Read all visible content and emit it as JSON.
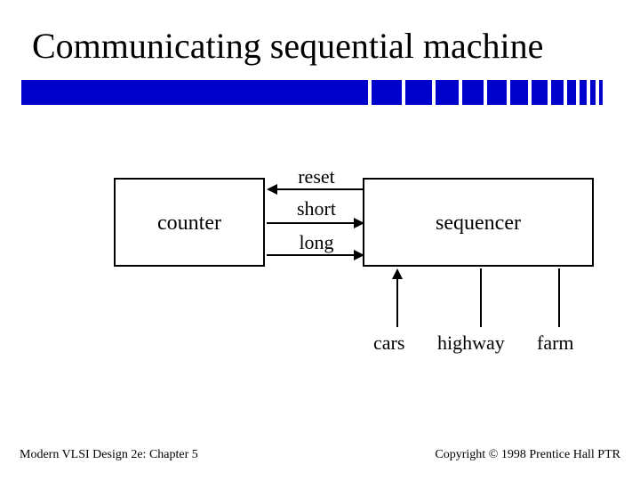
{
  "title": "Communicating sequential machine",
  "boxes": {
    "counter": "counter",
    "sequencer": "sequencer"
  },
  "signals": {
    "reset": "reset",
    "short": "short",
    "long": "long"
  },
  "io": {
    "cars": "cars",
    "highway": "highway",
    "farm": "farm"
  },
  "footer": {
    "left": "Modern VLSI Design 2e: Chapter 5",
    "right": "Copyright © 1998 Prentice Hall PTR"
  },
  "colors": {
    "accent": "#0000cc"
  }
}
